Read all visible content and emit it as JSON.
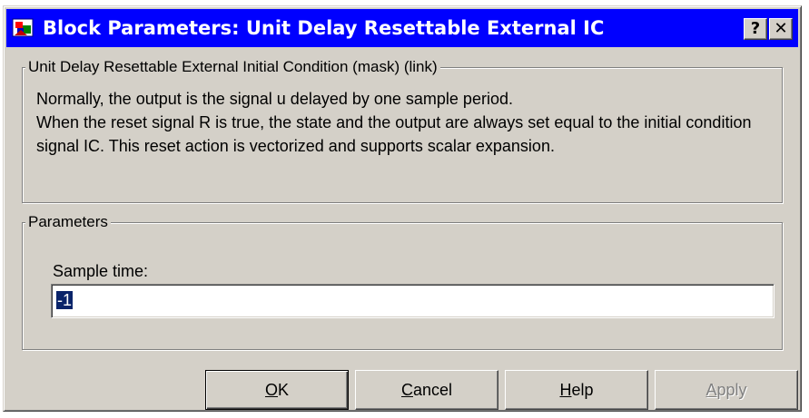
{
  "window": {
    "title": "Block Parameters: Unit Delay Resettable External IC"
  },
  "titlebar_buttons": {
    "help": "?",
    "close": "✕"
  },
  "description_group": {
    "legend": "Unit Delay Resettable External Initial Condition (mask) (link)",
    "lines": [
      "Normally, the output is the signal u delayed by one sample period.",
      "When the reset signal R is true, the state and the output are always set equal to the initial condition signal IC.  This reset action is vectorized and supports scalar expansion."
    ]
  },
  "parameters_group": {
    "legend": "Parameters",
    "sample_time_label": "Sample time:",
    "sample_time_value": "-1"
  },
  "buttons": {
    "ok": {
      "mnemonic": "O",
      "rest": "K"
    },
    "cancel": {
      "mnemonic": "C",
      "rest": "ancel"
    },
    "help": {
      "mnemonic": "H",
      "rest": "elp"
    },
    "apply": {
      "mnemonic": "A",
      "rest": "pply",
      "enabled": false
    }
  },
  "colors": {
    "titlebar": "#0000ff",
    "face": "#d4d0c8",
    "selection": "#0a246a"
  }
}
